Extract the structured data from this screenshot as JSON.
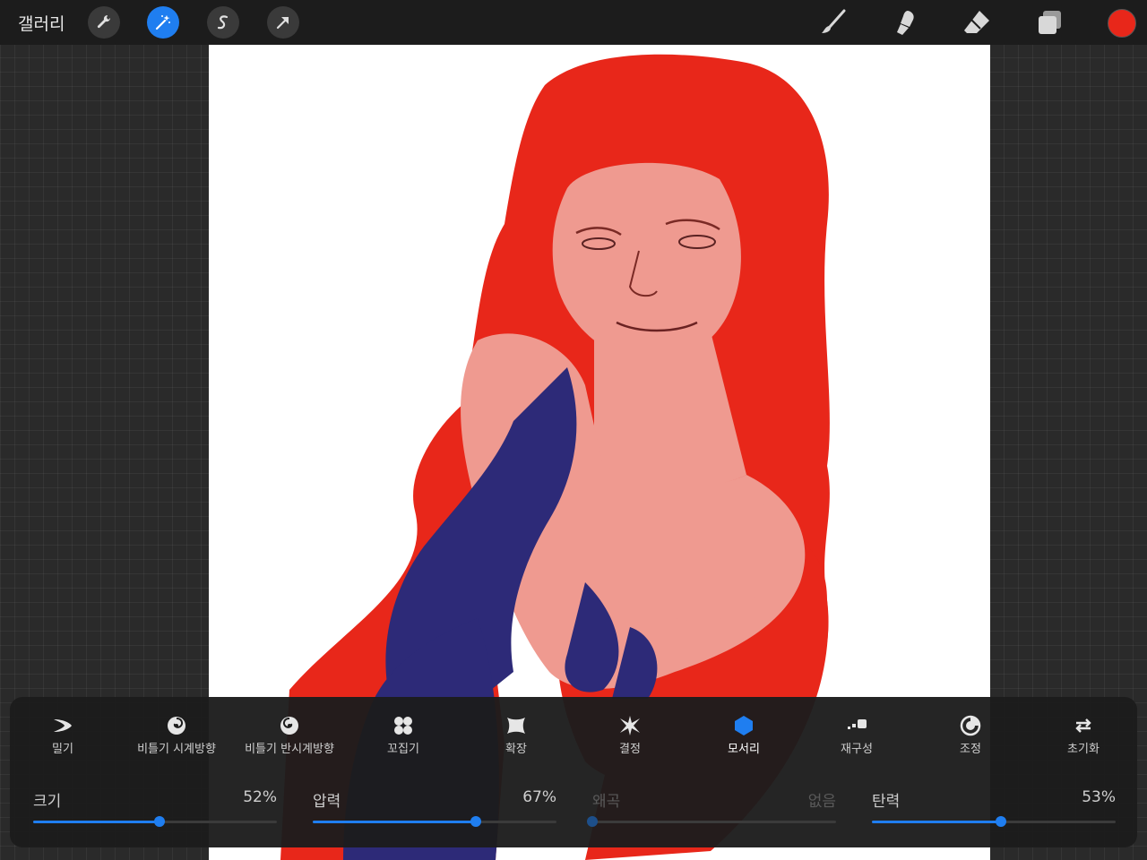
{
  "topbar": {
    "gallery_label": "갤러리",
    "tools_left": [
      "wrench-icon",
      "magic-wand-icon",
      "selection-s-icon",
      "move-arrow-icon"
    ],
    "tools_right": [
      "brush-icon",
      "smudge-icon",
      "eraser-icon",
      "layers-icon"
    ],
    "active_tool": "magic-wand-icon",
    "current_color": "#e8271a"
  },
  "liquify": {
    "modes": [
      {
        "id": "push",
        "label": "밀기",
        "icon": "push-icon"
      },
      {
        "id": "twirl-right",
        "label": "비틀기 시계방향",
        "icon": "twirl-clockwise-icon"
      },
      {
        "id": "twirl-left",
        "label": "비틀기 반시계방향",
        "icon": "twirl-counterclockwise-icon"
      },
      {
        "id": "pinch",
        "label": "꼬집기",
        "icon": "pinch-icon"
      },
      {
        "id": "expand",
        "label": "확장",
        "icon": "expand-icon"
      },
      {
        "id": "crystals",
        "label": "결정",
        "icon": "crystals-icon"
      },
      {
        "id": "edge",
        "label": "모서리",
        "icon": "edge-icon"
      },
      {
        "id": "reconstruct",
        "label": "재구성",
        "icon": "reconstruct-icon"
      },
      {
        "id": "adjust",
        "label": "조정",
        "icon": "adjust-icon"
      },
      {
        "id": "reset",
        "label": "초기화",
        "icon": "reset-icon"
      }
    ],
    "active_mode": "edge",
    "sliders": [
      {
        "name": "크기",
        "value_text": "52%",
        "value": 0.52,
        "enabled": true
      },
      {
        "name": "압력",
        "value_text": "67%",
        "value": 0.67,
        "enabled": true
      },
      {
        "name": "왜곡",
        "value_text": "없음",
        "value": 0.0,
        "enabled": false
      },
      {
        "name": "탄력",
        "value_text": "53%",
        "value": 0.53,
        "enabled": true
      }
    ]
  },
  "colors": {
    "accent": "#1f7ef0",
    "hair": "#e8271a",
    "skin": "#ef9a90",
    "dress": "#2d2a78"
  }
}
